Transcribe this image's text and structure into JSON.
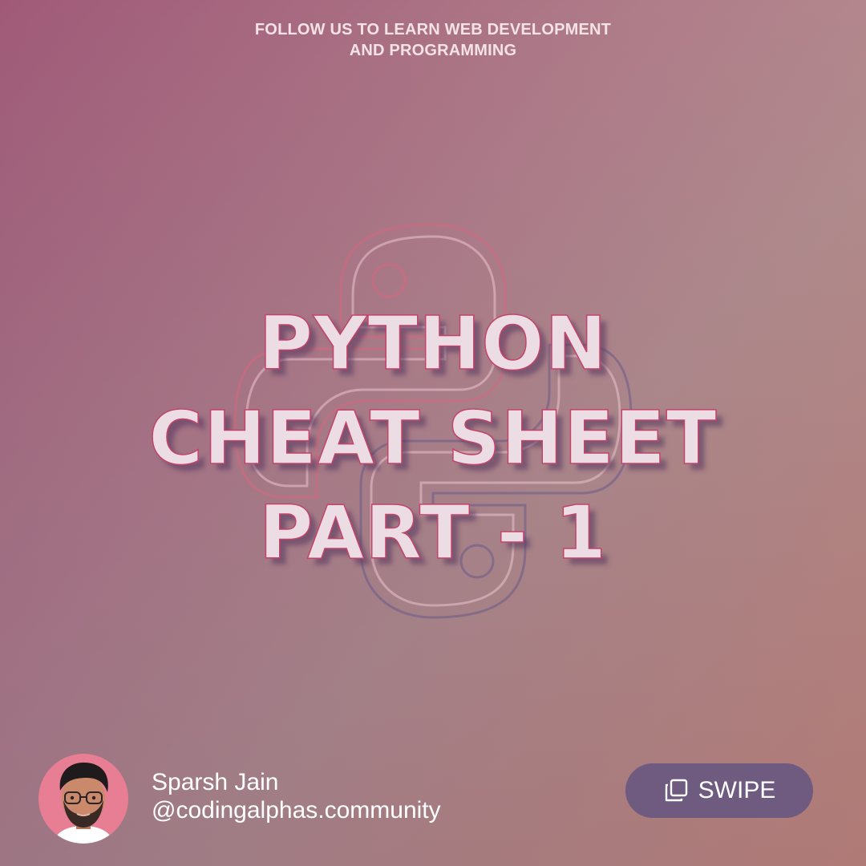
{
  "banner": {
    "line1": "FOLLOW US TO LEARN WEB DEVELOPMENT",
    "line2": "AND PROGRAMMING"
  },
  "title": {
    "line1": "PYTHON",
    "line2": "CHEAT SHEET",
    "line3": "PART - 1"
  },
  "author": {
    "name": "Sparsh Jain",
    "handle": "@codingalphas.community"
  },
  "swipe": {
    "label": "SWIPE",
    "icon": "copy-icon"
  },
  "background_logo": {
    "icon": "python-logo-icon"
  },
  "colors": {
    "background_start": "#a05a78",
    "background_end": "#c98c7c",
    "title_fill": "#ecdde4",
    "title_stroke": "#c4436a",
    "swipe_button": "#6f5a80",
    "avatar_bg": "#e77e93"
  }
}
